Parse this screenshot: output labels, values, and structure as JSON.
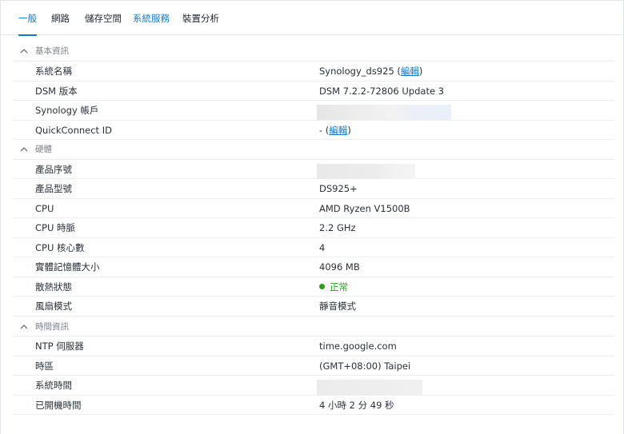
{
  "tabs": [
    {
      "label": "一般",
      "active": true
    },
    {
      "label": "網路"
    },
    {
      "label": "儲存空間"
    },
    {
      "label": "系統服務"
    },
    {
      "label": "裝置分析"
    }
  ],
  "sections": {
    "basic": {
      "title": "基本資訊",
      "system_name": {
        "label": "系統名稱",
        "value": "Synology_ds925",
        "edit": "編輯"
      },
      "dsm_version": {
        "label": "DSM 版本",
        "value": "DSM 7.2.2-72806 Update 3"
      },
      "synology_account": {
        "label": "Synology 帳戶"
      },
      "quickconnect": {
        "label": "QuickConnect ID",
        "value": "-",
        "edit": "編輯"
      }
    },
    "hardware": {
      "title": "硬體",
      "serial": {
        "label": "產品序號"
      },
      "model": {
        "label": "產品型號",
        "value": "DS925+"
      },
      "cpu": {
        "label": "CPU",
        "value": "AMD Ryzen V1500B"
      },
      "cpu_clock": {
        "label": "CPU 時脈",
        "value": "2.2 GHz"
      },
      "cpu_cores": {
        "label": "CPU 核心數",
        "value": "4"
      },
      "memory": {
        "label": "實體記憶體大小",
        "value": "4096 MB"
      },
      "thermal": {
        "label": "散熱狀態",
        "value": "正常",
        "color": "#27a11b"
      },
      "fan": {
        "label": "風扇模式",
        "value": "靜音模式"
      }
    },
    "time": {
      "title": "時間資訊",
      "ntp": {
        "label": "NTP 伺服器",
        "value": "time.google.com"
      },
      "timezone": {
        "label": "時區",
        "value": "(GMT+08:00) Taipei"
      },
      "system_time": {
        "label": "系統時間"
      },
      "uptime": {
        "label": "已開機時間",
        "value": "4 小時 2 分 49 秒"
      }
    }
  },
  "icons": {
    "section_toggle": "chevron-up-icon",
    "status": "status-dot-icon"
  },
  "colors": {
    "accent": "#0c7ad6",
    "ok": "#27a11b"
  }
}
